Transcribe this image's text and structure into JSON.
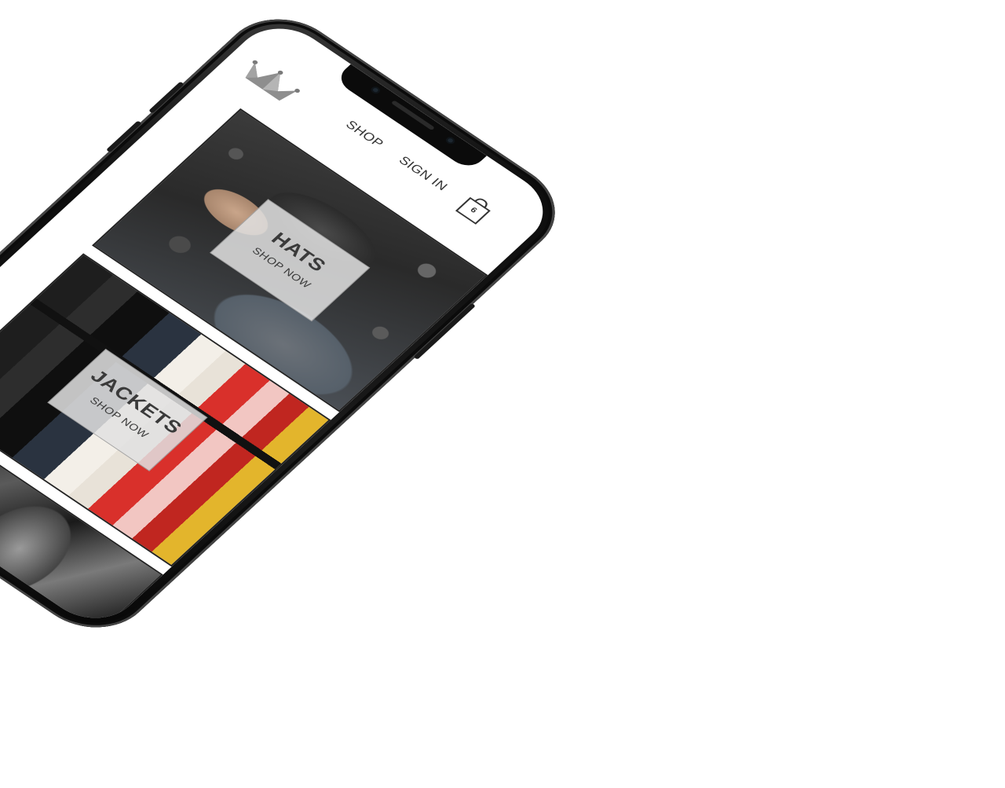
{
  "header": {
    "brand_icon": "crown-icon",
    "nav": [
      {
        "label": "SHOP"
      },
      {
        "label": "SIGN IN"
      }
    ],
    "cart": {
      "icon": "shopping-bag-icon",
      "count": "6"
    }
  },
  "categories": [
    {
      "title": "HATS",
      "cta": "SHOP NOW"
    },
    {
      "title": "JACKETS",
      "cta": "SHOP NOW"
    }
  ],
  "colors": {
    "frame": "#111111",
    "screen": "#ffffff",
    "text": "#333333",
    "logo": "#9a9a9a"
  }
}
